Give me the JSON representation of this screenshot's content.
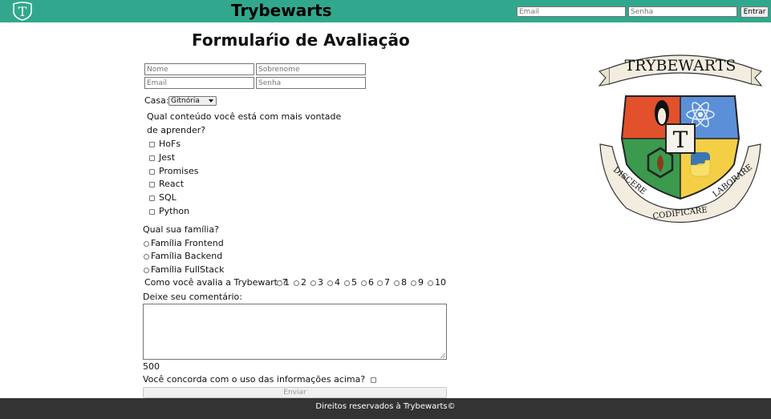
{
  "header": {
    "title": "Trybewarts",
    "logo_letter": "T",
    "login": {
      "email_placeholder": "Email",
      "password_placeholder": "Senha",
      "button_label": "Entrar"
    }
  },
  "form": {
    "title": "Formulaŕio de Avaliação",
    "name_placeholder": "Nome",
    "lastname_placeholder": "Sobrenome",
    "email_placeholder": "Email",
    "house_placeholder": "Senha",
    "house_label": "Casa:",
    "house_selected": "Gitnória",
    "content_question_line1": "Qual conteúdo você está com mais vontade",
    "content_question_line2": "de aprender?",
    "subjects": [
      "HoFs",
      "Jest",
      "Promises",
      "React",
      "SQL",
      "Python"
    ],
    "family_question": "Qual sua família?",
    "families": [
      "Família Frontend",
      "Família Backend",
      "Família FullStack"
    ],
    "rating_label": "Como você avalia a Trybewarts?",
    "ratings": [
      "1",
      "2",
      "3",
      "4",
      "5",
      "6",
      "7",
      "8",
      "9",
      "10"
    ],
    "comment_label": "Deixe seu comentário:",
    "char_counter": "500",
    "agreement_label": "Você concorda com o uso das informações acima?",
    "submit_label": "Enviar"
  },
  "crest": {
    "banner_text": "TRYBEWARTS",
    "center_letter": "T",
    "motto": [
      "DISCERE",
      "CODIFICARE",
      "LABORARE"
    ]
  },
  "footer": {
    "text": "Direitos reservados à Trybewarts©"
  },
  "colors": {
    "header_bg": "#31a88d",
    "footer_bg": "#333333",
    "crest_red": "#e2512c",
    "crest_blue": "#5b8fd8",
    "crest_green": "#3b9a4e",
    "crest_yellow": "#f4cf46"
  }
}
